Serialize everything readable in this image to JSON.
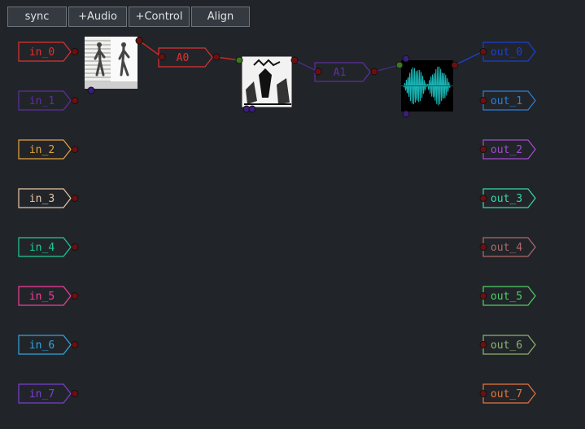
{
  "toolbar": {
    "buttons": [
      {
        "id": "sync",
        "label": "sync"
      },
      {
        "id": "add-audio",
        "label": "+Audio"
      },
      {
        "id": "add-control",
        "label": "+Control"
      },
      {
        "id": "align",
        "label": "Align"
      }
    ]
  },
  "inputs": [
    {
      "label": "in_0",
      "color": "#e03131"
    },
    {
      "label": "in_1",
      "color": "#5f2fa0"
    },
    {
      "label": "in_2",
      "color": "#e8a33c"
    },
    {
      "label": "in_3",
      "color": "#e8c6a8"
    },
    {
      "label": "in_4",
      "color": "#20c997"
    },
    {
      "label": "in_5",
      "color": "#f03e9a"
    },
    {
      "label": "in_6",
      "color": "#33a4e0"
    },
    {
      "label": "in_7",
      "color": "#7a3fd0"
    }
  ],
  "outputs": [
    {
      "label": "out_0",
      "color": "#1c3fcf"
    },
    {
      "label": "out_1",
      "color": "#2f7fd9"
    },
    {
      "label": "out_2",
      "color": "#a64bd8"
    },
    {
      "label": "out_3",
      "color": "#38d9a9"
    },
    {
      "label": "out_4",
      "color": "#b06a6a"
    },
    {
      "label": "out_5",
      "color": "#51cf66"
    },
    {
      "label": "out_6",
      "color": "#8fb573"
    },
    {
      "label": "out_7",
      "color": "#e8733c"
    }
  ],
  "processors": [
    {
      "label": "A0",
      "color": "#e03131"
    },
    {
      "label": "A1",
      "color": "#5f2fa0"
    }
  ],
  "images": [
    {
      "name": "walking-figures-image"
    },
    {
      "name": "engraving-image"
    },
    {
      "name": "waveform-image",
      "wave_color": "#19b5b5"
    }
  ],
  "colors": {
    "background": "#212529",
    "port": "#6b1010",
    "port_input_green": "#3a7a1c",
    "port_blue": "#3b1e7a",
    "link_red": "#c92a2a",
    "link_purple": "#4c2a8a",
    "link_blue": "#1c3fcf"
  }
}
